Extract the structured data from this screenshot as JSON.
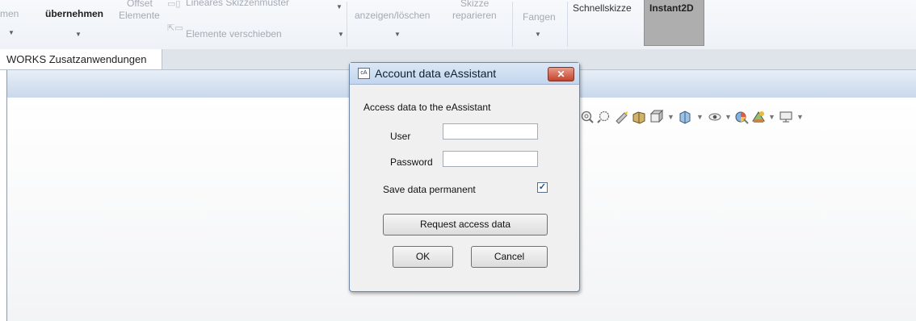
{
  "ribbon": {
    "item_men": "men",
    "item_uebernehmen": "übernehmen",
    "item_offset_line1": "Offset",
    "item_offset_line2": "Elemente",
    "item_lineares": "Lineares Skizzenmuster",
    "item_verschieben": "Elemente verschieben",
    "item_anzeigen": "anzeigen/löschen",
    "item_skizze_line1": "Skizze",
    "item_skizze_line2": "reparieren",
    "item_fangen": "Fangen",
    "item_schnellskizze": "Schnellskizze",
    "item_instant2d": "Instant2D"
  },
  "tabbar": {
    "active_tab": "WORKS Zusatzanwendungen"
  },
  "toolbar_icons": [
    "zoom-fit-icon",
    "zoom-area-icon",
    "previous-view-icon",
    "section-view-icon",
    "view-orientation-icon",
    "display-style-icon",
    "hide-show-icon",
    "edit-appearance-icon",
    "apply-scene-icon",
    "view-settings-icon"
  ],
  "dialog": {
    "title": "Account data eAssistant",
    "title_icon_text": "cA",
    "close_glyph": "✕",
    "heading": "Access data to the eAssistant",
    "user_label": "User",
    "user_value": "",
    "password_label": "Password",
    "password_value": "",
    "save_label": "Save data permanent",
    "save_checked": true,
    "check_glyph": "✓",
    "request_button": "Request access data",
    "ok_button": "OK",
    "cancel_button": "Cancel"
  }
}
